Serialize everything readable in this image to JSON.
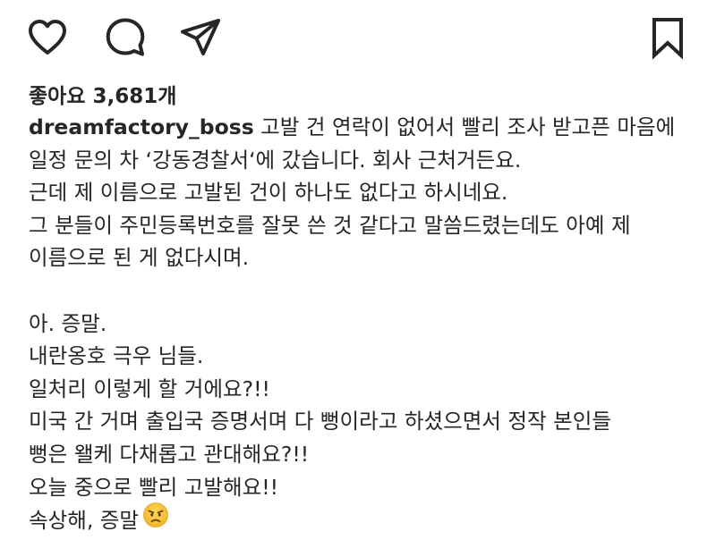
{
  "actions": {
    "like_icon": "heart-outline",
    "comment_icon": "comment-bubble",
    "share_icon": "paper-plane",
    "save_icon": "bookmark-outline"
  },
  "likes": {
    "text": "좋아요 3,681개"
  },
  "caption": {
    "username": "dreamfactory_boss",
    "first_line_text": " 고발 건 연락이 없어서 빨리 조사 받고픈 마음에",
    "lines": [
      "일정 문의 차 ‘강동경찰서‘에 갔습니다. 회사 근처거든요.",
      "근데 제 이름으로 고발된 건이 하나도 없다고 하시네요.",
      "그 분들이 주민등록번호를 잘못 쓴 것 같다고 말씀드렸는데도 아예 제",
      "이름으로 된 게 없다시며.",
      "",
      "아. 증말.",
      "내란옹호 극우 님들.",
      "일처리 이렇게 할 거에요?!!",
      "미국 간 거며 출입국 증명서며 다 뻥이라고 하셨으면서 정작 본인들",
      "뻥은 왤케 다채롭고 관대해요?!!",
      "오늘 중으로 빨리 고발해요!!"
    ],
    "last_line_text": "속상해, 증말",
    "last_line_emoji": "angry-face-emoji"
  },
  "colors": {
    "text": "#262626",
    "background": "#ffffff",
    "emoji_face": "#f5c53a",
    "emoji_feature": "#6b3e12"
  }
}
